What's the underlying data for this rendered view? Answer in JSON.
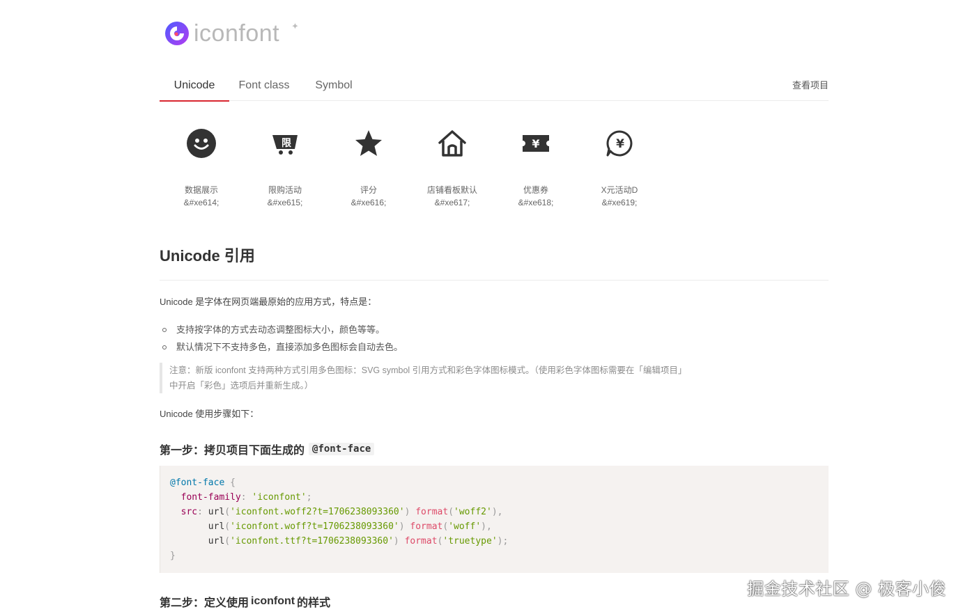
{
  "header": {
    "logo_text": "iconfont",
    "logo_star": "✦"
  },
  "tabs": [
    {
      "label": "Unicode",
      "active": true
    },
    {
      "label": "Font class",
      "active": false
    },
    {
      "label": "Symbol",
      "active": false
    }
  ],
  "project_link": "查看项目",
  "icons": [
    {
      "name": "数据展示",
      "code": "&#xe614;",
      "icon": "smiley-icon"
    },
    {
      "name": "限购活动",
      "code": "&#xe615;",
      "icon": "limited-purchase-icon"
    },
    {
      "name": "评分",
      "code": "&#xe616;",
      "icon": "star-icon"
    },
    {
      "name": "店铺看板默认",
      "code": "&#xe617;",
      "icon": "store-home-icon"
    },
    {
      "name": "优惠券",
      "code": "&#xe618;",
      "icon": "coupon-icon"
    },
    {
      "name": "X元活动D",
      "code": "&#xe619;",
      "icon": "yuan-chat-icon"
    }
  ],
  "section_title": "Unicode 引用",
  "intro": "Unicode 是字体在网页端最原始的应用方式，特点是：",
  "bullets": [
    "支持按字体的方式去动态调整图标大小，颜色等等。",
    "默认情况下不支持多色，直接添加多色图标会自动去色。"
  ],
  "note": {
    "line1": "注意：新版 iconfont 支持两种方式引用多色图标：SVG symbol 引用方式和彩色字体图标模式。（使用彩色字体图标需要在「编辑项目」",
    "line2": "中开启「彩色」选项后并重新生成。）"
  },
  "steps_intro": "Unicode 使用步骤如下：",
  "step1": {
    "label": "第一步：拷贝项目下面生成的",
    "code": "@font-face"
  },
  "code": {
    "at_rule": "@font-face",
    "open_brace": "{",
    "close_brace": "}",
    "family_prop": "font-family",
    "family_value": "'iconfont'",
    "src_prop": "src",
    "url1": "'iconfont.woff2?t=1706238093360'",
    "fmt1": "'woff2'",
    "url2": "'iconfont.woff?t=1706238093360'",
    "fmt2": "'woff'",
    "url3": "'iconfont.ttf?t=1706238093360'",
    "fmt3": "'truetype'",
    "url_fn": "url",
    "format_fn": "format"
  },
  "step2": {
    "prefix": "第二步：定义使用",
    "bold": "iconfont",
    "suffix": "的样式"
  },
  "watermark": "掘金技术社区 @ 极客小俊",
  "colors": {
    "accent": "#d9262f",
    "logo_purple": "#6a3df0",
    "icon": "#333333"
  }
}
